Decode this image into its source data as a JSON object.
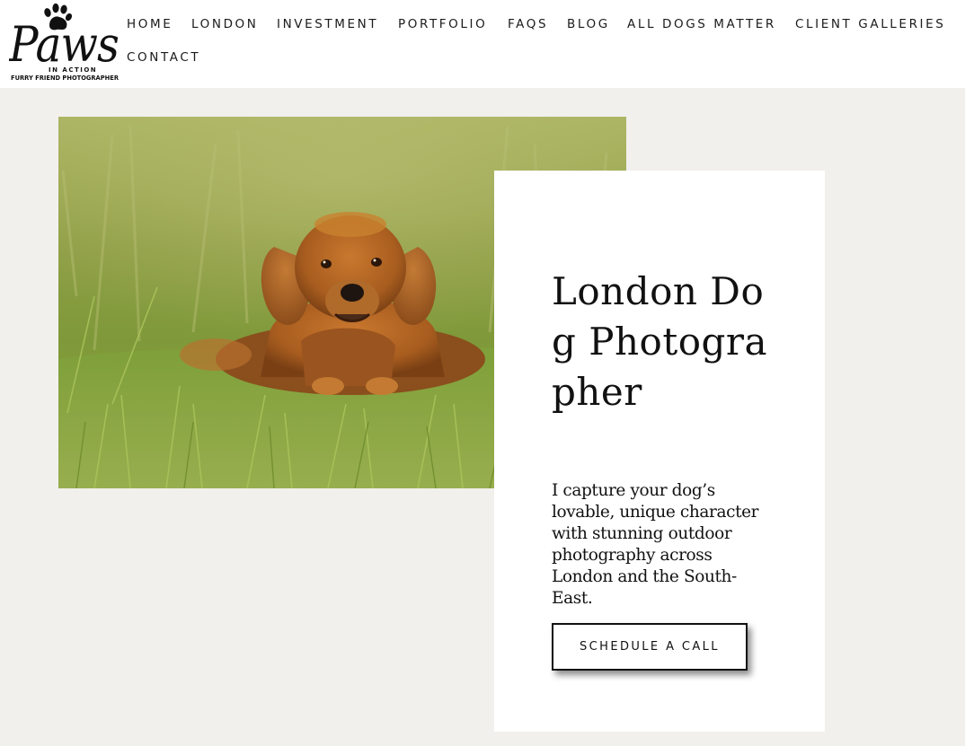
{
  "site": {
    "logo": {
      "word": "Paws",
      "tag": "IN ACTION",
      "subtitle": "FURRY FRIEND PHOTOGRAPHER"
    }
  },
  "nav": {
    "items": [
      {
        "label": "HOME"
      },
      {
        "label": "LONDON"
      },
      {
        "label": "INVESTMENT"
      },
      {
        "label": "PORTFOLIO"
      },
      {
        "label": "FAQS"
      },
      {
        "label": "BLOG"
      },
      {
        "label": "ALL DOGS MATTER"
      },
      {
        "label": "CLIENT GALLERIES"
      },
      {
        "label": "CONTACT"
      }
    ]
  },
  "hero": {
    "image": "photo of a golden cocker spaniel lying in long green grass",
    "title": "London Dog Photographer",
    "description": "I capture your dog’s lovable, unique character with stunning outdoor photography across London and the South-East.",
    "cta_label": "SCHEDULE A CALL"
  },
  "colors": {
    "page_bg": "#f1f0ed",
    "header_bg": "#ffffff",
    "card_bg": "#ffffff",
    "text": "#111111"
  }
}
